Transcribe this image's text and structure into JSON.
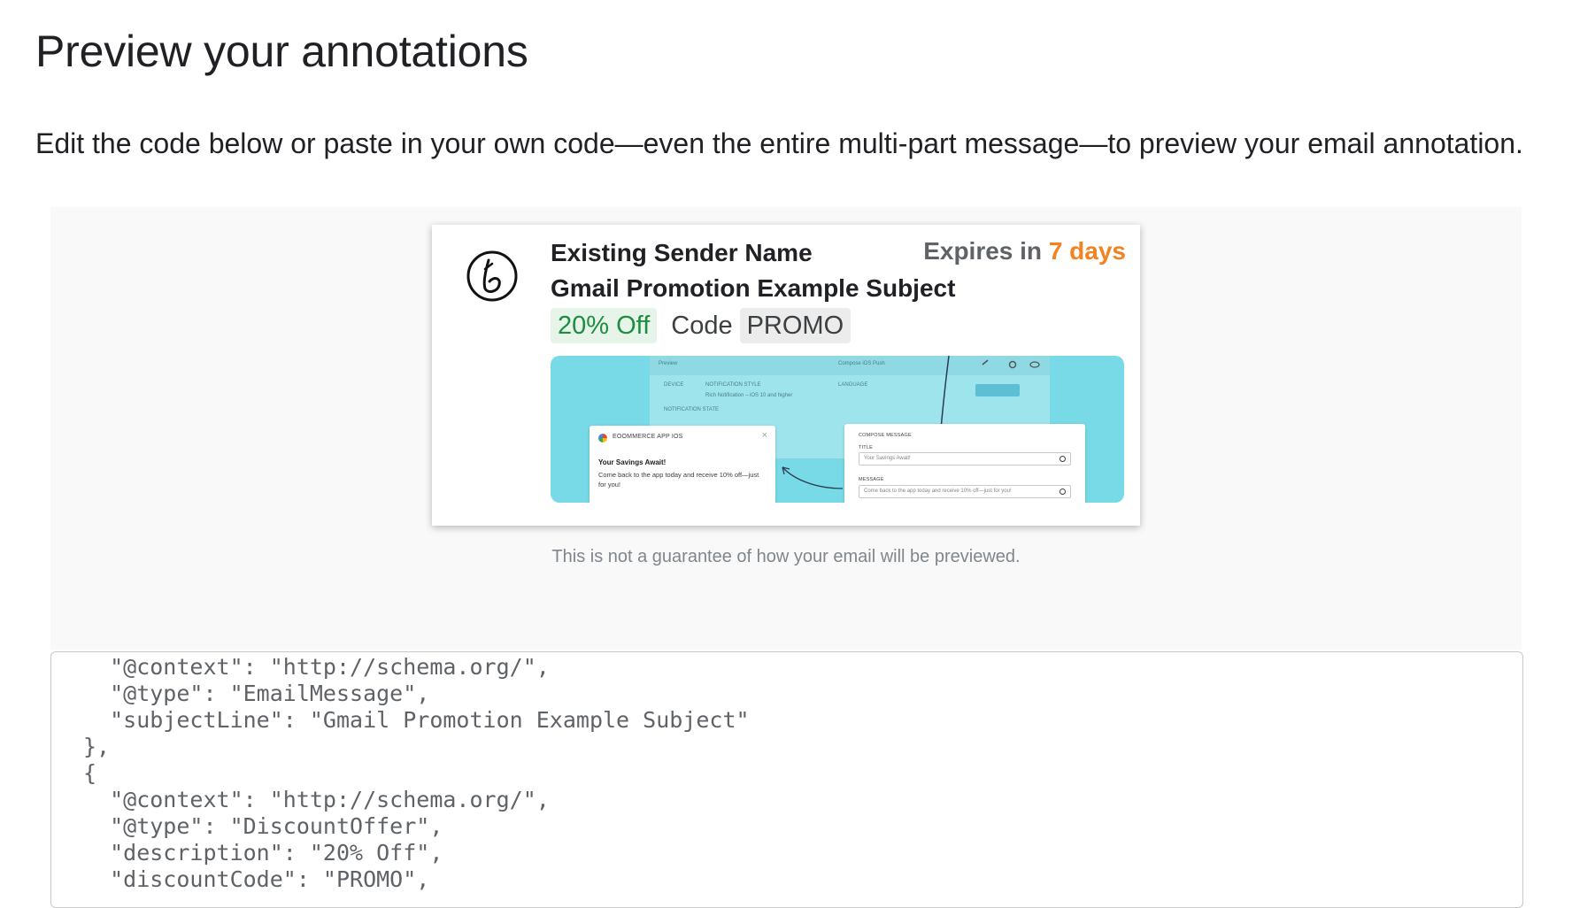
{
  "page": {
    "title": "Preview your annotations",
    "intro": "Edit the code below or paste in your own code—even the entire multi-part message—to preview your email annotation."
  },
  "preview": {
    "sender_name": "Existing Sender Name",
    "subject": "Gmail Promotion Example Subject",
    "expires_prefix": "Expires in",
    "expires_days": "7 days",
    "discount": "20% Off",
    "code_label": "Code",
    "code_value": "PROMO",
    "avatar_icon": "brand-logo-b-icon",
    "disclaimer": "This is not a guarantee of how your email will be previewed.",
    "colors": {
      "expires_accent": "#f58220",
      "discount_text": "#1e8e3e",
      "discount_bg": "#e6f4ea",
      "image_bg": "#77dae6"
    },
    "image": {
      "toolbar_left": "Preview",
      "toolbar_mid": "Compose iOS Push",
      "device_label": "DEVICE",
      "notification_style_label": "NOTIFICATION STYLE",
      "notification_style_value": "Rich Notification – iOS 10 and higher",
      "notification_state_label": "NOTIFICATION STATE",
      "language_label": "LANGUAGE",
      "notif_app": "EOOMMERCE APP IOS",
      "notif_title": "Your Savings Await!",
      "notif_body": "Come back to the app today and receive 10% off—just for you!",
      "compose_header": "COMPOSE MESSAGE",
      "compose_title_label": "TITLE",
      "compose_title_value": "Your Savings Await!",
      "compose_message_label": "MESSAGE",
      "compose_message_value": "Come back to the app today and receive 10% off—just for you!"
    }
  },
  "code": {
    "lines": [
      "  \"@context\": \"http://schema.org/\",",
      "  \"@type\": \"EmailMessage\",",
      "  \"subjectLine\": \"Gmail Promotion Example Subject\"",
      "},",
      "{",
      "  \"@context\": \"http://schema.org/\",",
      "  \"@type\": \"DiscountOffer\",",
      "  \"description\": \"20% Off\",",
      "  \"discountCode\": \"PROMO\","
    ]
  }
}
